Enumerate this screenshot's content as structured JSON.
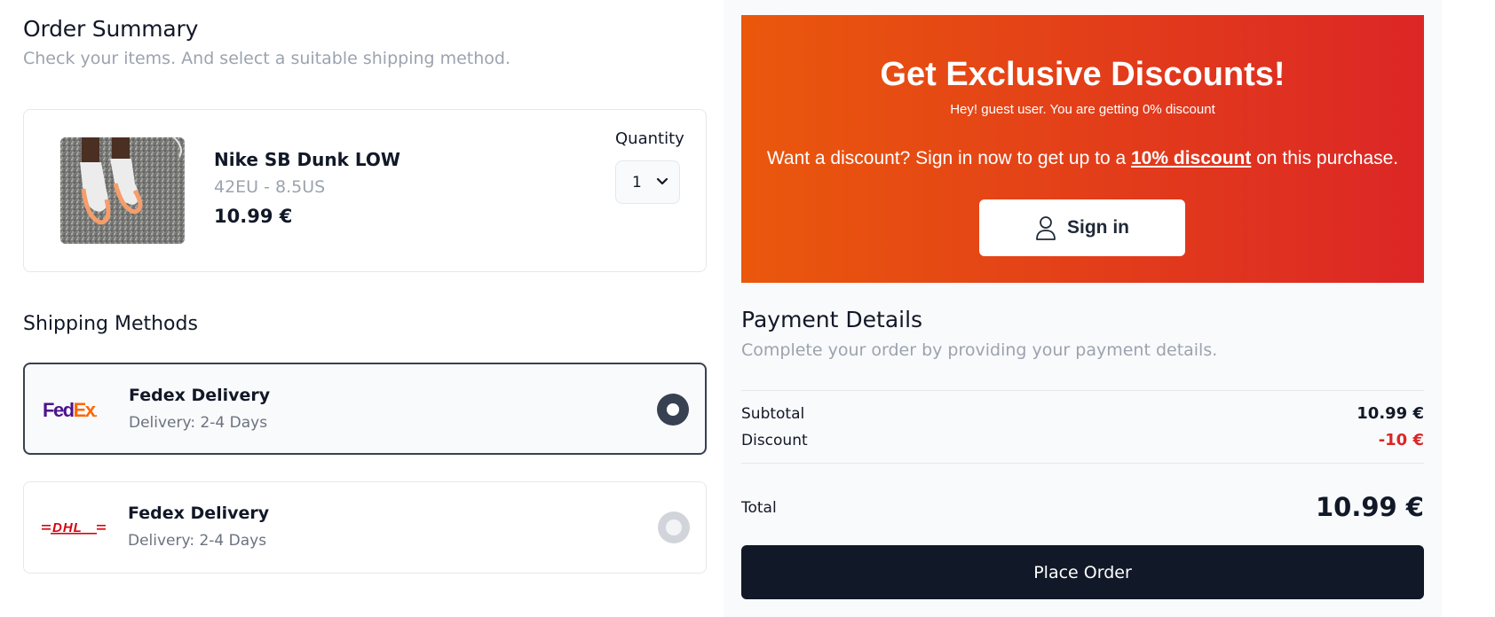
{
  "order_summary": {
    "title": "Order Summary",
    "subtitle": "Check your items. And select a suitable shipping method."
  },
  "item": {
    "name": "Nike SB Dunk LOW",
    "variant": "42EU - 8.5US",
    "price": "10.99 €",
    "quantity_label": "Quantity",
    "quantity_value": "1"
  },
  "shipping": {
    "title": "Shipping Methods",
    "methods": [
      {
        "logo": "FedEx.",
        "name": "Fedex Delivery",
        "delivery": "Delivery: 2-4 Days",
        "selected": true
      },
      {
        "logo": "DHL",
        "name": "Fedex Delivery",
        "delivery": "Delivery: 2-4 Days",
        "selected": false
      }
    ]
  },
  "promo": {
    "title": "Get Exclusive Discounts!",
    "note": "Hey! guest user. You are getting 0% discount",
    "text_before": "Want a discount? Sign in now to get up to a ",
    "text_highlight": "10% discount",
    "text_after": " on this purchase.",
    "signin_label": "Sign in",
    "colors": {
      "gradient_start": "#ea580c",
      "gradient_end": "#dc2626"
    }
  },
  "payment": {
    "title": "Payment Details",
    "subtitle": "Complete your order by providing your payment details.",
    "subtotal_label": "Subtotal",
    "subtotal_value": "10.99 €",
    "discount_label": "Discount",
    "discount_value": "-10 €",
    "total_label": "Total",
    "total_value": "10.99 €",
    "place_order_label": "Place Order"
  },
  "icons": {
    "select_chevron": "chevron-down-icon",
    "signin": "user-icon"
  }
}
